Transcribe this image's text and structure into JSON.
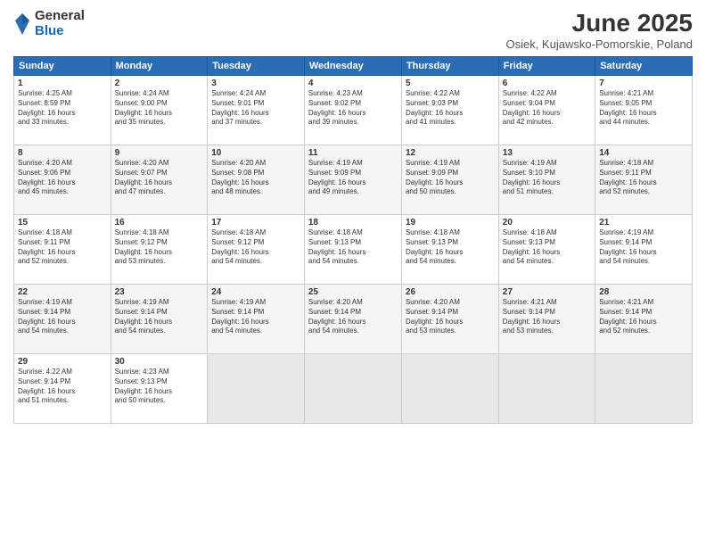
{
  "logo": {
    "general": "General",
    "blue": "Blue"
  },
  "title": "June 2025",
  "subtitle": "Osiek, Kujawsko-Pomorskie, Poland",
  "days_of_week": [
    "Sunday",
    "Monday",
    "Tuesday",
    "Wednesday",
    "Thursday",
    "Friday",
    "Saturday"
  ],
  "weeks": [
    [
      {
        "day": 1,
        "info": "Sunrise: 4:25 AM\nSunset: 8:59 PM\nDaylight: 16 hours\nand 33 minutes."
      },
      {
        "day": 2,
        "info": "Sunrise: 4:24 AM\nSunset: 9:00 PM\nDaylight: 16 hours\nand 35 minutes."
      },
      {
        "day": 3,
        "info": "Sunrise: 4:24 AM\nSunset: 9:01 PM\nDaylight: 16 hours\nand 37 minutes."
      },
      {
        "day": 4,
        "info": "Sunrise: 4:23 AM\nSunset: 9:02 PM\nDaylight: 16 hours\nand 39 minutes."
      },
      {
        "day": 5,
        "info": "Sunrise: 4:22 AM\nSunset: 9:03 PM\nDaylight: 16 hours\nand 41 minutes."
      },
      {
        "day": 6,
        "info": "Sunrise: 4:22 AM\nSunset: 9:04 PM\nDaylight: 16 hours\nand 42 minutes."
      },
      {
        "day": 7,
        "info": "Sunrise: 4:21 AM\nSunset: 9:05 PM\nDaylight: 16 hours\nand 44 minutes."
      }
    ],
    [
      {
        "day": 8,
        "info": "Sunrise: 4:20 AM\nSunset: 9:06 PM\nDaylight: 16 hours\nand 45 minutes."
      },
      {
        "day": 9,
        "info": "Sunrise: 4:20 AM\nSunset: 9:07 PM\nDaylight: 16 hours\nand 47 minutes."
      },
      {
        "day": 10,
        "info": "Sunrise: 4:20 AM\nSunset: 9:08 PM\nDaylight: 16 hours\nand 48 minutes."
      },
      {
        "day": 11,
        "info": "Sunrise: 4:19 AM\nSunset: 9:09 PM\nDaylight: 16 hours\nand 49 minutes."
      },
      {
        "day": 12,
        "info": "Sunrise: 4:19 AM\nSunset: 9:09 PM\nDaylight: 16 hours\nand 50 minutes."
      },
      {
        "day": 13,
        "info": "Sunrise: 4:19 AM\nSunset: 9:10 PM\nDaylight: 16 hours\nand 51 minutes."
      },
      {
        "day": 14,
        "info": "Sunrise: 4:18 AM\nSunset: 9:11 PM\nDaylight: 16 hours\nand 52 minutes."
      }
    ],
    [
      {
        "day": 15,
        "info": "Sunrise: 4:18 AM\nSunset: 9:11 PM\nDaylight: 16 hours\nand 52 minutes."
      },
      {
        "day": 16,
        "info": "Sunrise: 4:18 AM\nSunset: 9:12 PM\nDaylight: 16 hours\nand 53 minutes."
      },
      {
        "day": 17,
        "info": "Sunrise: 4:18 AM\nSunset: 9:12 PM\nDaylight: 16 hours\nand 54 minutes."
      },
      {
        "day": 18,
        "info": "Sunrise: 4:18 AM\nSunset: 9:13 PM\nDaylight: 16 hours\nand 54 minutes."
      },
      {
        "day": 19,
        "info": "Sunrise: 4:18 AM\nSunset: 9:13 PM\nDaylight: 16 hours\nand 54 minutes."
      },
      {
        "day": 20,
        "info": "Sunrise: 4:18 AM\nSunset: 9:13 PM\nDaylight: 16 hours\nand 54 minutes."
      },
      {
        "day": 21,
        "info": "Sunrise: 4:19 AM\nSunset: 9:14 PM\nDaylight: 16 hours\nand 54 minutes."
      }
    ],
    [
      {
        "day": 22,
        "info": "Sunrise: 4:19 AM\nSunset: 9:14 PM\nDaylight: 16 hours\nand 54 minutes."
      },
      {
        "day": 23,
        "info": "Sunrise: 4:19 AM\nSunset: 9:14 PM\nDaylight: 16 hours\nand 54 minutes."
      },
      {
        "day": 24,
        "info": "Sunrise: 4:19 AM\nSunset: 9:14 PM\nDaylight: 16 hours\nand 54 minutes."
      },
      {
        "day": 25,
        "info": "Sunrise: 4:20 AM\nSunset: 9:14 PM\nDaylight: 16 hours\nand 54 minutes."
      },
      {
        "day": 26,
        "info": "Sunrise: 4:20 AM\nSunset: 9:14 PM\nDaylight: 16 hours\nand 53 minutes."
      },
      {
        "day": 27,
        "info": "Sunrise: 4:21 AM\nSunset: 9:14 PM\nDaylight: 16 hours\nand 53 minutes."
      },
      {
        "day": 28,
        "info": "Sunrise: 4:21 AM\nSunset: 9:14 PM\nDaylight: 16 hours\nand 52 minutes."
      }
    ],
    [
      {
        "day": 29,
        "info": "Sunrise: 4:22 AM\nSunset: 9:14 PM\nDaylight: 16 hours\nand 51 minutes."
      },
      {
        "day": 30,
        "info": "Sunrise: 4:23 AM\nSunset: 9:13 PM\nDaylight: 16 hours\nand 50 minutes."
      },
      null,
      null,
      null,
      null,
      null
    ]
  ]
}
